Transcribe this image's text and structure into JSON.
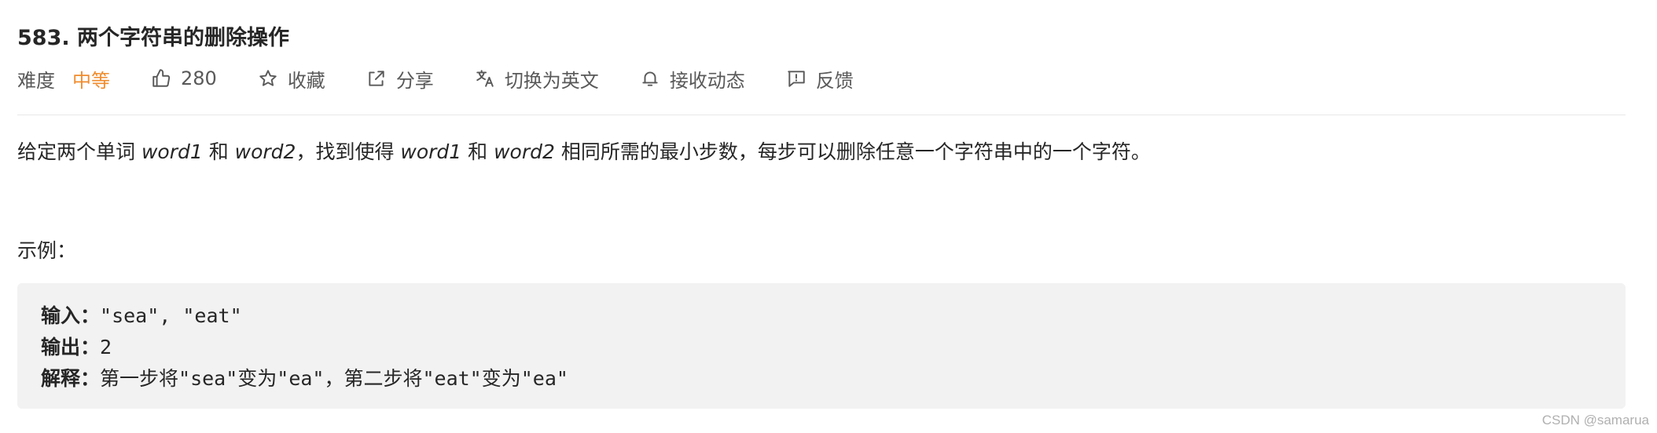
{
  "problem": {
    "title": "583. 两个字符串的删除操作"
  },
  "meta": {
    "difficulty_label": "难度",
    "difficulty_value": "中等",
    "difficulty_color": "#f08c2e",
    "likes_count": "280",
    "favorite_label": "收藏",
    "share_label": "分享",
    "switch_language_label": "切换为英文",
    "subscribe_label": "接收动态",
    "feedback_label": "反馈",
    "icons": [
      "thumbs-up-icon",
      "star-icon",
      "share-icon",
      "translate-icon",
      "bell-icon",
      "feedback-icon"
    ]
  },
  "description": {
    "part1": "给定两个单词 ",
    "word1": "word1",
    "part2": " 和 ",
    "word2": "word2",
    "part3": "，找到使得 ",
    "word1b": "word1",
    "part4": " 和 ",
    "word2b": "word2",
    "part5": " 相同所需的最小步数，每步可以删除任意一个字符串中的一个字符。"
  },
  "example": {
    "heading": "示例：",
    "input_label": "输入：",
    "input_value": "\"sea\", \"eat\"",
    "output_label": "输出：",
    "output_value": "2",
    "explanation_label": "解释：",
    "explanation_value": "第一步将\"sea\"变为\"ea\"，第二步将\"eat\"变为\"ea\""
  },
  "watermark": "CSDN @samarua"
}
